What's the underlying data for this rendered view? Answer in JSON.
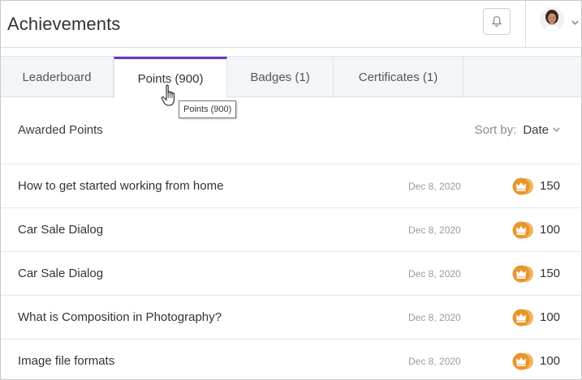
{
  "header": {
    "title": "Achievements"
  },
  "tabs": [
    {
      "label": "Leaderboard",
      "active": false
    },
    {
      "label": "Points (900)",
      "active": true
    },
    {
      "label": "Badges (1)",
      "active": false
    },
    {
      "label": "Certificates (1)",
      "active": false
    }
  ],
  "tooltip": "Points (900)",
  "section": {
    "title": "Awarded Points",
    "sort_label": "Sort by:",
    "sort_value": "Date"
  },
  "rows": [
    {
      "title": "How to get started working from home",
      "date": "Dec 8, 2020",
      "points": "150"
    },
    {
      "title": "Car Sale Dialog",
      "date": "Dec 8, 2020",
      "points": "100"
    },
    {
      "title": "Car Sale Dialog",
      "date": "Dec 8, 2020",
      "points": "150"
    },
    {
      "title": "What is Composition in Photography?",
      "date": "Dec 8, 2020",
      "points": "100"
    },
    {
      "title": "Image file formats",
      "date": "Dec 8, 2020",
      "points": "100"
    }
  ],
  "colors": {
    "accent": "#6d37c4",
    "badge": "#e89a2c"
  },
  "icons": {
    "bell": "bell-icon",
    "points_badge": "crown-coin-icon",
    "caret": "chevron-down-icon"
  }
}
